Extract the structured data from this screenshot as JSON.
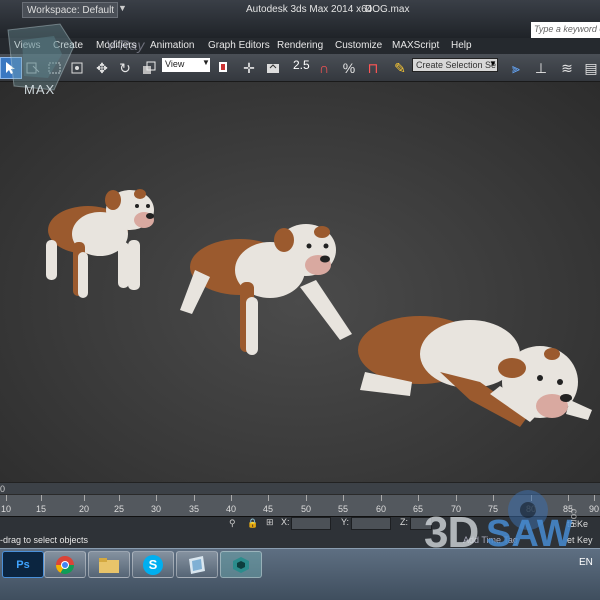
{
  "titlebar": {
    "workspace_label": "Workspace: Default",
    "app_title": "Autodesk 3ds Max  2014 x64",
    "file_name": "DOG.max",
    "search_placeholder": "Type a keyword or"
  },
  "menubar": {
    "items": [
      "Views",
      "Create",
      "Modifiers",
      "Animation",
      "Graph Editors",
      "Rendering",
      "Customize",
      "MAXScript",
      "Help"
    ]
  },
  "logo": {
    "text": "MAX",
    "overlay_text": "V-Ray"
  },
  "toolbar": {
    "view_dropdown": "View",
    "snap_value": "2.5",
    "selection_set": "Create Selection Se"
  },
  "timeline": {
    "frame_indicator": "0",
    "ticks": [
      "10",
      "15",
      "20",
      "25",
      "30",
      "35",
      "40",
      "45",
      "50",
      "55",
      "60",
      "65",
      "70",
      "75",
      "80",
      "85",
      "90"
    ]
  },
  "status": {
    "x_label": "X:",
    "y_label": "Y:",
    "z_label": "Z:",
    "message": "-drag to select objects",
    "auto_key": "to Ke",
    "set_key": "et Key",
    "add_time_tag": "Add Time Tag"
  },
  "taskbar": {
    "apps": [
      "photoshop-icon",
      "chrome-icon",
      "file-explorer-icon",
      "skype-icon",
      "document-icon",
      "3dsmax-icon"
    ],
    "language": "EN"
  },
  "watermark": {
    "part1": "3D",
    "part2": "SAW",
    "suffix": ".com"
  },
  "colors": {
    "accent_blue": "#3a78c2",
    "dog_brown": "#9b5a2e",
    "dog_white": "#e8e4de",
    "viewport_bg": "#3a3a3a"
  }
}
